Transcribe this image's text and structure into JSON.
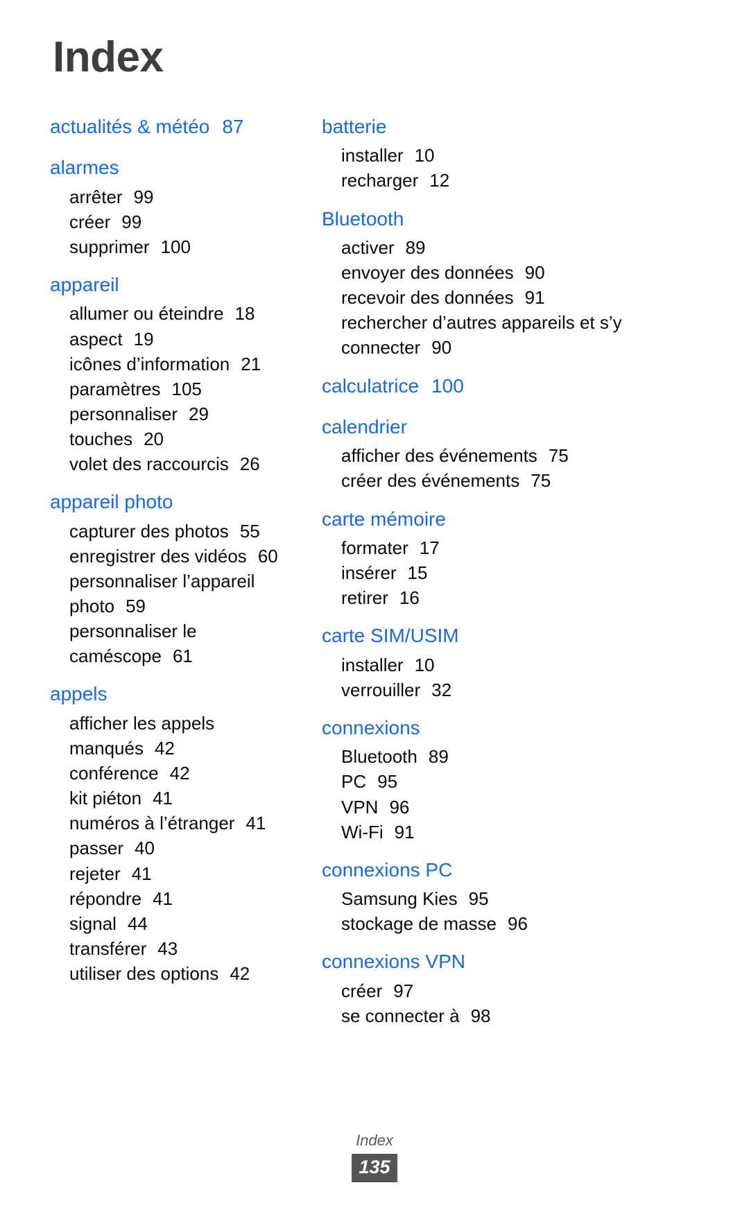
{
  "page_title": "Index",
  "colors": {
    "heading_blue": "#1769e0",
    "title_gray": "#3d3d3d",
    "badge_bg": "#555555",
    "body_text": "#0a0a0a"
  },
  "columns": [
    {
      "id": "left",
      "groups": [
        {
          "heading": "actualités & météo",
          "heading_page": "87",
          "subentries": []
        },
        {
          "heading": "alarmes",
          "heading_page": "",
          "subentries": [
            {
              "label": "arrêter",
              "page": "99"
            },
            {
              "label": "créer",
              "page": "99"
            },
            {
              "label": "supprimer",
              "page": "100"
            }
          ]
        },
        {
          "heading": "appareil",
          "heading_page": "",
          "subentries": [
            {
              "label": "allumer ou éteindre",
              "page": "18"
            },
            {
              "label": "aspect",
              "page": "19"
            },
            {
              "label": "icônes d’information",
              "page": "21"
            },
            {
              "label": "paramètres",
              "page": "105"
            },
            {
              "label": "personnaliser",
              "page": "29"
            },
            {
              "label": "touches",
              "page": "20"
            },
            {
              "label": "volet des raccourcis",
              "page": "26"
            }
          ]
        },
        {
          "heading": "appareil photo",
          "heading_page": "",
          "subentries": [
            {
              "label": "capturer des photos",
              "page": "55"
            },
            {
              "label": "enregistrer des vidéos",
              "page": "60"
            },
            {
              "label": "personnaliser l’appareil photo",
              "page": "59"
            },
            {
              "label": "personnaliser le caméscope",
              "page": "61"
            }
          ]
        },
        {
          "heading": "appels",
          "heading_page": "",
          "subentries": [
            {
              "label": "afficher les appels manqués",
              "page": "42"
            },
            {
              "label": "conférence",
              "page": "42"
            },
            {
              "label": "kit piéton",
              "page": "41"
            },
            {
              "label": "numéros à l’étranger",
              "page": "41"
            },
            {
              "label": "passer",
              "page": "40"
            },
            {
              "label": "rejeter",
              "page": "41"
            },
            {
              "label": "répondre",
              "page": "41"
            },
            {
              "label": "signal",
              "page": "44"
            },
            {
              "label": "transférer",
              "page": "43"
            },
            {
              "label": "utiliser des options",
              "page": "42"
            }
          ]
        }
      ]
    },
    {
      "id": "right",
      "groups": [
        {
          "heading": "batterie",
          "heading_page": "",
          "subentries": [
            {
              "label": "installer",
              "page": "10"
            },
            {
              "label": "recharger",
              "page": "12"
            }
          ]
        },
        {
          "heading": "Bluetooth",
          "heading_page": "",
          "subentries": [
            {
              "label": "activer",
              "page": "89"
            },
            {
              "label": "envoyer des données",
              "page": "90"
            },
            {
              "label": "recevoir des données",
              "page": "91"
            },
            {
              "label": "rechercher d’autres appareils et s’y connecter",
              "page": "90"
            }
          ]
        },
        {
          "heading": "calculatrice",
          "heading_page": "100",
          "subentries": []
        },
        {
          "heading": "calendrier",
          "heading_page": "",
          "subentries": [
            {
              "label": "afficher des événements",
              "page": "75"
            },
            {
              "label": "créer des événements",
              "page": "75"
            }
          ]
        },
        {
          "heading": "carte mémoire",
          "heading_page": "",
          "subentries": [
            {
              "label": "formater",
              "page": "17"
            },
            {
              "label": "insérer",
              "page": "15"
            },
            {
              "label": "retirer",
              "page": "16"
            }
          ]
        },
        {
          "heading": "carte SIM/USIM",
          "heading_page": "",
          "subentries": [
            {
              "label": "installer",
              "page": "10"
            },
            {
              "label": "verrouiller",
              "page": "32"
            }
          ]
        },
        {
          "heading": "connexions",
          "heading_page": "",
          "subentries": [
            {
              "label": "Bluetooth",
              "page": "89"
            },
            {
              "label": "PC",
              "page": "95"
            },
            {
              "label": "VPN",
              "page": "96"
            },
            {
              "label": "Wi-Fi",
              "page": "91"
            }
          ]
        },
        {
          "heading": "connexions PC",
          "heading_page": "",
          "subentries": [
            {
              "label": "Samsung Kies",
              "page": "95"
            },
            {
              "label": "stockage de masse",
              "page": "96"
            }
          ]
        },
        {
          "heading": "connexions VPN",
          "heading_page": "",
          "subentries": [
            {
              "label": "créer",
              "page": "97"
            },
            {
              "label": "se connecter à",
              "page": "98"
            }
          ]
        }
      ]
    }
  ],
  "footer": {
    "label": "Index",
    "page_number": "135"
  }
}
